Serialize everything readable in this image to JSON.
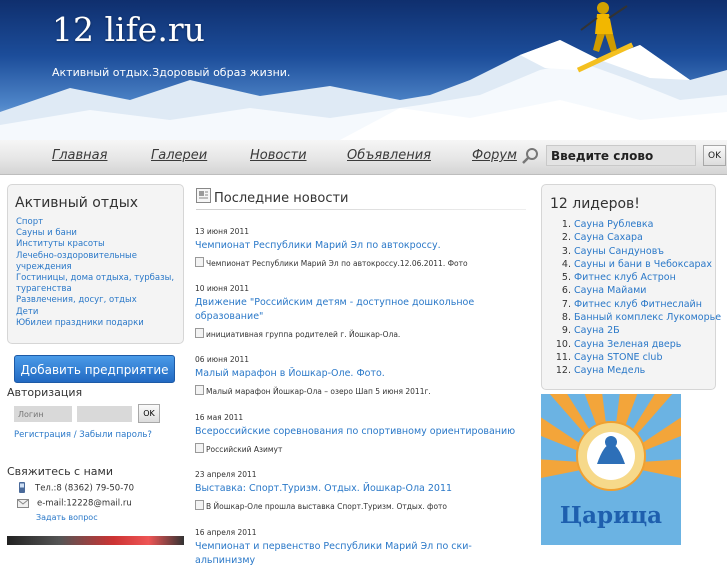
{
  "header": {
    "site_title_main": "12 life",
    "site_title_tld": ".ru",
    "tagline": "Активный отдых.Здоровый образ жизни."
  },
  "nav": {
    "items": [
      "Главная",
      "Галереи",
      "Новости",
      "Объявления",
      "Форум"
    ]
  },
  "search": {
    "value": "Введите слово",
    "button_label": "OK"
  },
  "left_sidebar": {
    "title": "Активный отдых",
    "categories": [
      "Спорт",
      "Сауны и бани",
      "Институты красоты",
      "Лечебно-оздоровительные учреждения",
      "Гостиницы, дома отдыха, турбазы, турагенства",
      "Развлечения, досуг, отдых",
      "Дети",
      "Юбилеи праздники подарки"
    ],
    "add_button_label": "Добавить предприятие"
  },
  "auth": {
    "title": "Авторизация",
    "login_placeholder": "Логин",
    "button_label": "OK",
    "links": "Регистрация / Забыли пароль?"
  },
  "contact": {
    "title": "Свяжитесь с нами",
    "phone": "Тел.:8 (8362) 79-50-70",
    "email": "e-mail:12228@mail.ru",
    "ask_link": "Задать вопрос"
  },
  "news": {
    "title": "Последние новости",
    "items": [
      {
        "date": "13 июня 2011",
        "title": "Чемпионат Республики Марий Эл по автокроссу.",
        "summary": "Чемпионат Республики Марий Эл по автокроссу.12.06.2011. Фото"
      },
      {
        "date": "10 июня 2011",
        "title": "Движение \"Российским детям - доступное дошкольное образование\"",
        "summary": "инициативная группа родителей г. Йошкар-Ола."
      },
      {
        "date": "06 июня 2011",
        "title": "Малый марафон в Йошкар-Оле. Фото.",
        "summary": "Малый марафон Йошкар-Ола – озеро Шап 5 июня 2011г."
      },
      {
        "date": "16 мая 2011",
        "title": "Всероссийские соревнования по спортивному ориентированию",
        "summary": "Российский Азимут"
      },
      {
        "date": "23 апреля 2011",
        "title": "Выставка: Спорт.Туризм. Отдых. Йошкар-Ола 2011",
        "summary": "В Йошкар-Оле прошла выставка Спорт.Туризм. Отдых. фото"
      },
      {
        "date": "16 апреля 2011",
        "title": "Чемпионат и первенство Республики Марий Эл по ски-альпинизму",
        "summary": ""
      }
    ]
  },
  "leaders": {
    "title": "12 лидеров!",
    "items": [
      {
        "num": "1.",
        "name": "Сауна Рублевка"
      },
      {
        "num": "2.",
        "name": "Сауна Сахара"
      },
      {
        "num": "3.",
        "name": "Сауны Сандуновъ"
      },
      {
        "num": "4.",
        "name": "Сауны и бани в Чебоксарах"
      },
      {
        "num": "5.",
        "name": "Фитнес клуб Астрон"
      },
      {
        "num": "6.",
        "name": "Сауна Майами"
      },
      {
        "num": "7.",
        "name": "Фитнес клуб Фитнеслайн"
      },
      {
        "num": "8.",
        "name": "Банный комплекс Лукоморье"
      },
      {
        "num": "9.",
        "name": "Сауна 2Б"
      },
      {
        "num": "10.",
        "name": "Сауна Зеленая дверь"
      },
      {
        "num": "11.",
        "name": "Сауна STONE club"
      },
      {
        "num": "12.",
        "name": "Сауна Медель"
      }
    ]
  },
  "banner": {
    "text": "Царица"
  }
}
